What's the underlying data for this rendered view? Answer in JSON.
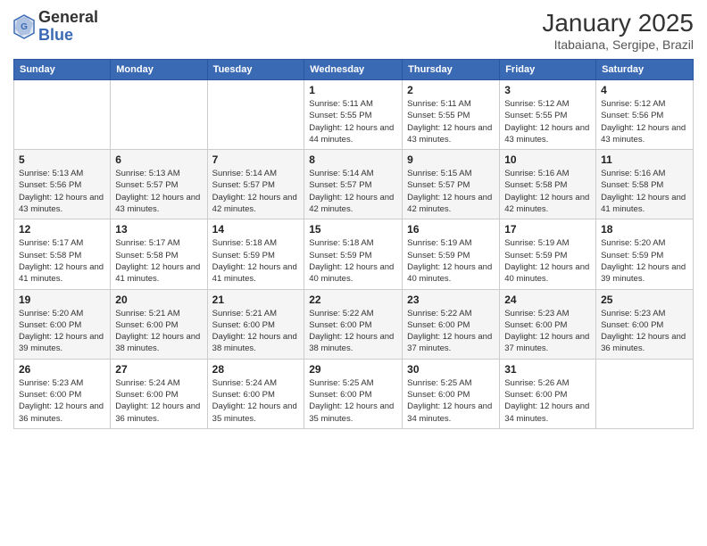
{
  "header": {
    "logo_general": "General",
    "logo_blue": "Blue",
    "month_title": "January 2025",
    "location": "Itabaiana, Sergipe, Brazil"
  },
  "days_of_week": [
    "Sunday",
    "Monday",
    "Tuesday",
    "Wednesday",
    "Thursday",
    "Friday",
    "Saturday"
  ],
  "weeks": [
    [
      {
        "day": "",
        "sunrise": "",
        "sunset": "",
        "daylight": ""
      },
      {
        "day": "",
        "sunrise": "",
        "sunset": "",
        "daylight": ""
      },
      {
        "day": "",
        "sunrise": "",
        "sunset": "",
        "daylight": ""
      },
      {
        "day": "1",
        "sunrise": "Sunrise: 5:11 AM",
        "sunset": "Sunset: 5:55 PM",
        "daylight": "Daylight: 12 hours and 44 minutes."
      },
      {
        "day": "2",
        "sunrise": "Sunrise: 5:11 AM",
        "sunset": "Sunset: 5:55 PM",
        "daylight": "Daylight: 12 hours and 43 minutes."
      },
      {
        "day": "3",
        "sunrise": "Sunrise: 5:12 AM",
        "sunset": "Sunset: 5:55 PM",
        "daylight": "Daylight: 12 hours and 43 minutes."
      },
      {
        "day": "4",
        "sunrise": "Sunrise: 5:12 AM",
        "sunset": "Sunset: 5:56 PM",
        "daylight": "Daylight: 12 hours and 43 minutes."
      }
    ],
    [
      {
        "day": "5",
        "sunrise": "Sunrise: 5:13 AM",
        "sunset": "Sunset: 5:56 PM",
        "daylight": "Daylight: 12 hours and 43 minutes."
      },
      {
        "day": "6",
        "sunrise": "Sunrise: 5:13 AM",
        "sunset": "Sunset: 5:57 PM",
        "daylight": "Daylight: 12 hours and 43 minutes."
      },
      {
        "day": "7",
        "sunrise": "Sunrise: 5:14 AM",
        "sunset": "Sunset: 5:57 PM",
        "daylight": "Daylight: 12 hours and 42 minutes."
      },
      {
        "day": "8",
        "sunrise": "Sunrise: 5:14 AM",
        "sunset": "Sunset: 5:57 PM",
        "daylight": "Daylight: 12 hours and 42 minutes."
      },
      {
        "day": "9",
        "sunrise": "Sunrise: 5:15 AM",
        "sunset": "Sunset: 5:57 PM",
        "daylight": "Daylight: 12 hours and 42 minutes."
      },
      {
        "day": "10",
        "sunrise": "Sunrise: 5:16 AM",
        "sunset": "Sunset: 5:58 PM",
        "daylight": "Daylight: 12 hours and 42 minutes."
      },
      {
        "day": "11",
        "sunrise": "Sunrise: 5:16 AM",
        "sunset": "Sunset: 5:58 PM",
        "daylight": "Daylight: 12 hours and 41 minutes."
      }
    ],
    [
      {
        "day": "12",
        "sunrise": "Sunrise: 5:17 AM",
        "sunset": "Sunset: 5:58 PM",
        "daylight": "Daylight: 12 hours and 41 minutes."
      },
      {
        "day": "13",
        "sunrise": "Sunrise: 5:17 AM",
        "sunset": "Sunset: 5:58 PM",
        "daylight": "Daylight: 12 hours and 41 minutes."
      },
      {
        "day": "14",
        "sunrise": "Sunrise: 5:18 AM",
        "sunset": "Sunset: 5:59 PM",
        "daylight": "Daylight: 12 hours and 41 minutes."
      },
      {
        "day": "15",
        "sunrise": "Sunrise: 5:18 AM",
        "sunset": "Sunset: 5:59 PM",
        "daylight": "Daylight: 12 hours and 40 minutes."
      },
      {
        "day": "16",
        "sunrise": "Sunrise: 5:19 AM",
        "sunset": "Sunset: 5:59 PM",
        "daylight": "Daylight: 12 hours and 40 minutes."
      },
      {
        "day": "17",
        "sunrise": "Sunrise: 5:19 AM",
        "sunset": "Sunset: 5:59 PM",
        "daylight": "Daylight: 12 hours and 40 minutes."
      },
      {
        "day": "18",
        "sunrise": "Sunrise: 5:20 AM",
        "sunset": "Sunset: 5:59 PM",
        "daylight": "Daylight: 12 hours and 39 minutes."
      }
    ],
    [
      {
        "day": "19",
        "sunrise": "Sunrise: 5:20 AM",
        "sunset": "Sunset: 6:00 PM",
        "daylight": "Daylight: 12 hours and 39 minutes."
      },
      {
        "day": "20",
        "sunrise": "Sunrise: 5:21 AM",
        "sunset": "Sunset: 6:00 PM",
        "daylight": "Daylight: 12 hours and 38 minutes."
      },
      {
        "day": "21",
        "sunrise": "Sunrise: 5:21 AM",
        "sunset": "Sunset: 6:00 PM",
        "daylight": "Daylight: 12 hours and 38 minutes."
      },
      {
        "day": "22",
        "sunrise": "Sunrise: 5:22 AM",
        "sunset": "Sunset: 6:00 PM",
        "daylight": "Daylight: 12 hours and 38 minutes."
      },
      {
        "day": "23",
        "sunrise": "Sunrise: 5:22 AM",
        "sunset": "Sunset: 6:00 PM",
        "daylight": "Daylight: 12 hours and 37 minutes."
      },
      {
        "day": "24",
        "sunrise": "Sunrise: 5:23 AM",
        "sunset": "Sunset: 6:00 PM",
        "daylight": "Daylight: 12 hours and 37 minutes."
      },
      {
        "day": "25",
        "sunrise": "Sunrise: 5:23 AM",
        "sunset": "Sunset: 6:00 PM",
        "daylight": "Daylight: 12 hours and 36 minutes."
      }
    ],
    [
      {
        "day": "26",
        "sunrise": "Sunrise: 5:23 AM",
        "sunset": "Sunset: 6:00 PM",
        "daylight": "Daylight: 12 hours and 36 minutes."
      },
      {
        "day": "27",
        "sunrise": "Sunrise: 5:24 AM",
        "sunset": "Sunset: 6:00 PM",
        "daylight": "Daylight: 12 hours and 36 minutes."
      },
      {
        "day": "28",
        "sunrise": "Sunrise: 5:24 AM",
        "sunset": "Sunset: 6:00 PM",
        "daylight": "Daylight: 12 hours and 35 minutes."
      },
      {
        "day": "29",
        "sunrise": "Sunrise: 5:25 AM",
        "sunset": "Sunset: 6:00 PM",
        "daylight": "Daylight: 12 hours and 35 minutes."
      },
      {
        "day": "30",
        "sunrise": "Sunrise: 5:25 AM",
        "sunset": "Sunset: 6:00 PM",
        "daylight": "Daylight: 12 hours and 34 minutes."
      },
      {
        "day": "31",
        "sunrise": "Sunrise: 5:26 AM",
        "sunset": "Sunset: 6:00 PM",
        "daylight": "Daylight: 12 hours and 34 minutes."
      },
      {
        "day": "",
        "sunrise": "",
        "sunset": "",
        "daylight": ""
      }
    ]
  ]
}
